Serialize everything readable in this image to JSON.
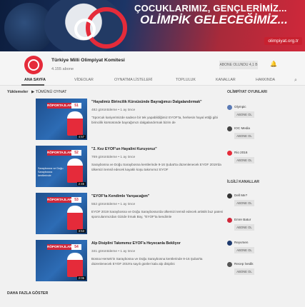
{
  "banner": {
    "title_line1": "ÇOCUKLARIMIZ, GENÇLERİMİZ...",
    "title_line2": "OLİMPİK GELECEĞİMİZ...",
    "site": "olimpiyat.org.tr",
    "colors": {
      "navy": "#0c1d3d",
      "red": "#d0283a"
    }
  },
  "channel": {
    "name": "Türkiye Milli Olimpiyat Komitesi",
    "subscribers": "4.155 abone",
    "subscribe_label": "ABONE OLUNDU 4,1 B",
    "bell_icon": "bell-icon"
  },
  "tabs": [
    {
      "label": "ANA SAYFA",
      "active": true
    },
    {
      "label": "VİDEOLAR",
      "active": false
    },
    {
      "label": "OYNATMA LİSTELERİ",
      "active": false
    },
    {
      "label": "TOPLULUK",
      "active": false
    },
    {
      "label": "KANALLAR",
      "active": false
    },
    {
      "label": "HAKKINDA",
      "active": false
    }
  ],
  "playlist": {
    "prefix": "Yüklemeler",
    "play_all": "▶ TÜMÜNÜ OYNAT"
  },
  "videos": [
    {
      "index": "",
      "tag": "RÖPORTAJLAR",
      "number": "51",
      "duration": "4:57",
      "caption": "",
      "title": "\"Hayalimiz Birincilik Kürsüsünde Bayrağımızı Dalgalandırmak\"",
      "meta": "482 görüntüleme • 1 ay önce",
      "desc": "\"Sporcuk kariyerimizde sadece bir tek yapabildiğimiz EYOF'ta, herkesin hayal ettiği gibi birincilik kürsüsünde bayrağımızı dalgalandırmak bizim de"
    },
    {
      "index": "",
      "tag": "RÖPORTAJLAR",
      "number": "52",
      "duration": "2:46",
      "caption": "Saraybosna ve Doğu Saraybosna kentlerinde",
      "title": "\"2. Kez EYOF'un Hayalini Kuruyoruz\"",
      "meta": "769 görüntüleme • 1 ay önce",
      "desc": "Saraybosna ve Doğu Saraybosna kentlerinde 9-16 Şubat'ta düzenlenecek EYOF 2019'da ülkemizi temsil edecek kayaklı koşu takımımız EYOF"
    },
    {
      "index": "",
      "tag": "RÖPORTAJLAR",
      "number": "53",
      "duration": "3:53",
      "caption": "",
      "title": "\"EYOF'ta Kendimle Yarışacağım\"",
      "meta": "552 görüntüleme • 1 ay önce",
      "desc": "EYOF 2019 Saraybosna ve Doğu Saraybosna'da ülkemizi temsil edecek artistik buz pateni sporcularımızdan Gizide İrmak Boy, \"EYOF'ta kendimle"
    },
    {
      "index": "",
      "tag": "RÖPORTAJLAR",
      "number": "54",
      "duration": "2:06",
      "caption": "",
      "title": "Alp Disiplini Takımımız EYOF'a Heyecanla Bekliyor",
      "meta": "341 görüntüleme • 1 ay önce",
      "desc": "Bosna Hersek'in Saraybosna ve Doğu Saraybosna kentlerinde 9-16 Şubat'ta düzenlenecek EYOF 2019'a sayılı günler kala alp disiplini"
    }
  ],
  "sidebar": {
    "heading1": "OLİMPİYAT OYUNLARI",
    "heading2": "İLGİLİ KANALLAR",
    "items": [
      {
        "name": "Olympic",
        "button": "ABONE OL",
        "color": "#5a7ab5"
      },
      {
        "name": "IOC Media",
        "button": "ABONE OL",
        "color": "#444444"
      },
      {
        "name": "Rio 2016",
        "button": "ABONE OL",
        "color": "#e52b3a"
      },
      {
        "name": "Dell Me?",
        "button": "ABONE OL",
        "color": "#333333"
      },
      {
        "name": "Emre Batur",
        "button": "ABONE OL",
        "color": "#d0283a"
      },
      {
        "name": "Reyvmen",
        "button": "ABONE OL",
        "color": "#1e3a6e"
      },
      {
        "name": "Recep İvedik",
        "button": "ABONE OL",
        "color": "#555555"
      }
    ]
  },
  "bottom_section": "DAHA FAZLA GÖSTER"
}
